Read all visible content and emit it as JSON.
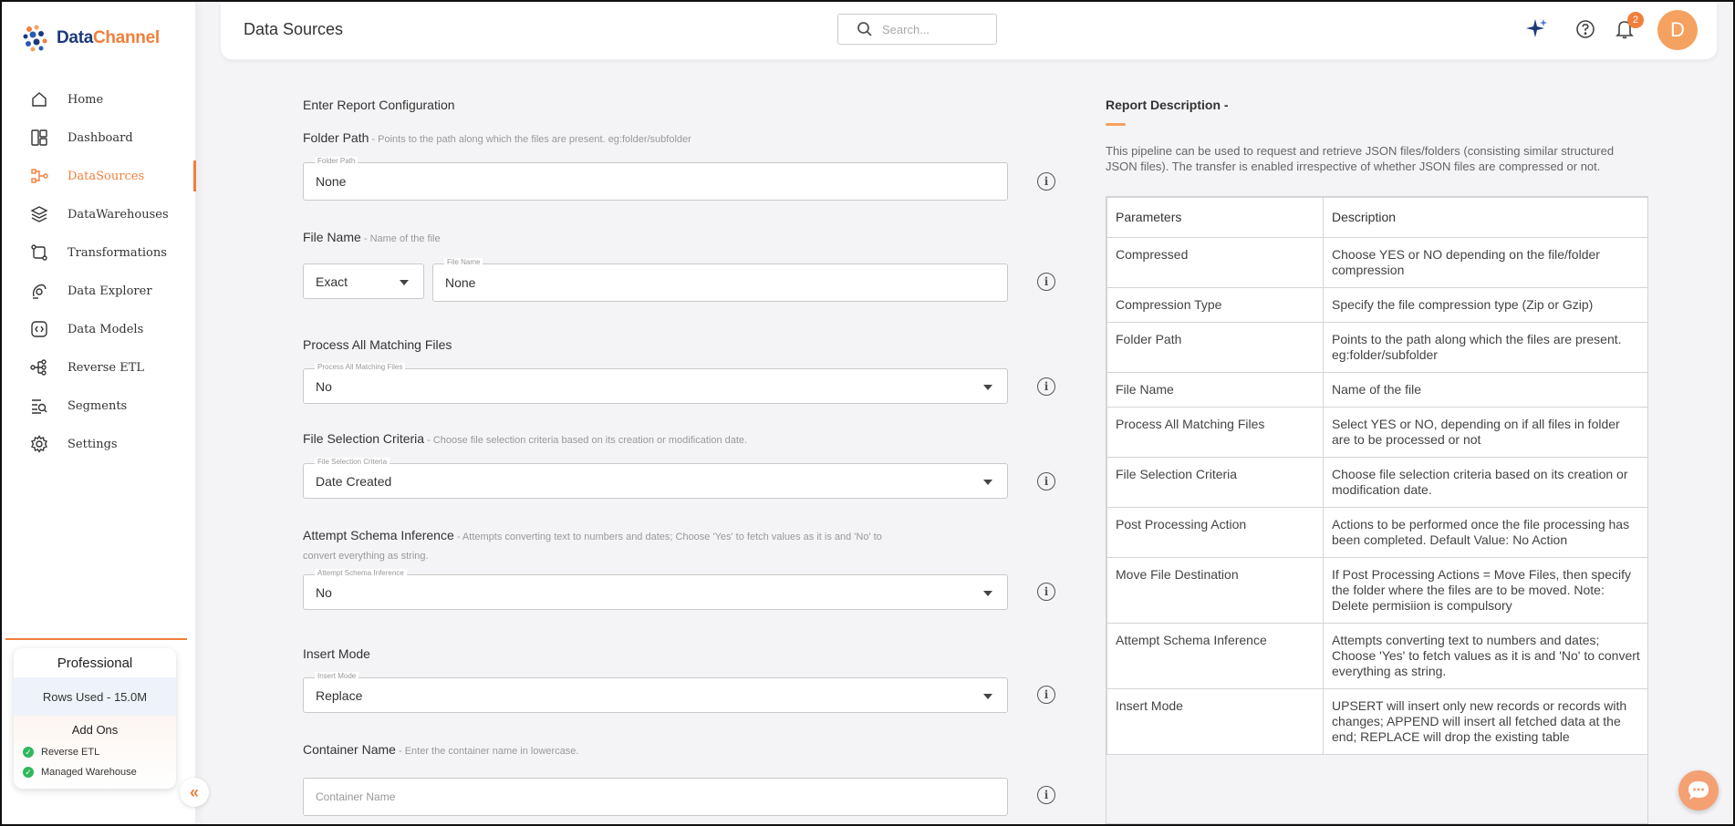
{
  "brand": {
    "part1": "Data",
    "part2": "Channel"
  },
  "sidebar": {
    "items": [
      {
        "label": "Home",
        "icon": "home-icon"
      },
      {
        "label": "Dashboard",
        "icon": "dashboard-icon"
      },
      {
        "label": "DataSources",
        "icon": "datasources-icon",
        "active": true
      },
      {
        "label": "DataWarehouses",
        "icon": "warehouse-layers-icon"
      },
      {
        "label": "Transformations",
        "icon": "transform-icon"
      },
      {
        "label": "Data Explorer",
        "icon": "explorer-icon"
      },
      {
        "label": "Data Models",
        "icon": "models-icon"
      },
      {
        "label": "Reverse ETL",
        "icon": "reverse-etl-icon"
      },
      {
        "label": "Segments",
        "icon": "segments-icon"
      },
      {
        "label": "Settings",
        "icon": "gear-icon"
      }
    ],
    "plan": {
      "name": "Professional",
      "rows_used": "Rows Used - 15.0M",
      "addons_title": "Add Ons",
      "addons": [
        "Reverse ETL",
        "Managed Warehouse"
      ]
    }
  },
  "header": {
    "title": "Data Sources",
    "search_placeholder": "Search...",
    "notification_count": "2",
    "avatar_initial": "D"
  },
  "form": {
    "heading": "Enter Report Configuration",
    "folder_path": {
      "label": "Folder Path",
      "hint": " - Points to the path along which the files are present. eg:folder/subfolder",
      "float": "Folder Path",
      "value": "None"
    },
    "file_name": {
      "label": "File Name",
      "hint": " - Name of the file",
      "match": "Exact",
      "float": "File Name",
      "value": "None"
    },
    "process_all": {
      "label": "Process All Matching Files",
      "float": "Process All Matching Files",
      "value": "No"
    },
    "selection": {
      "label": "File Selection Criteria",
      "hint": " - Choose file selection criteria based on its creation or modification date.",
      "float": "File Selection Criteria",
      "value": "Date Created"
    },
    "schema": {
      "label": "Attempt Schema Inference",
      "hint": " - Attempts converting text to numbers and dates; Choose 'Yes' to fetch values as it is and 'No' to",
      "hint2": "convert everything as string.",
      "float": "Attempt Schema Inference",
      "value": "No"
    },
    "insert_mode": {
      "label": "Insert Mode",
      "float": "Insert Mode",
      "value": "Replace"
    },
    "container": {
      "label": "Container Name",
      "hint": " - Enter the container name in lowercase.",
      "placeholder": "Container Name"
    }
  },
  "description": {
    "title": "Report Description -",
    "text": "This pipeline can be used to request and retrieve JSON files/folders (consisting similar structured JSON files). The transfer is enabled irrespective of whether JSON files are compressed or not.",
    "columns": [
      "Parameters",
      "Description"
    ],
    "rows": [
      [
        "Compressed",
        "Choose YES or NO depending on the file/folder compression"
      ],
      [
        "Compression Type",
        "Specify the file compression type (Zip or Gzip)"
      ],
      [
        "Folder Path",
        "Points to the path along which the files are present. eg:folder/subfolder"
      ],
      [
        "File Name",
        "Name of the file"
      ],
      [
        "Process All Matching Files",
        "Select YES or NO, depending on if all files in folder are to be processed or not"
      ],
      [
        "File Selection Criteria",
        "Choose file selection criteria based on its creation or modification date."
      ],
      [
        "Post Processing Action",
        "Actions to be performed once the file processing has been completed. Default Value: No Action"
      ],
      [
        "Move File Destination",
        "If Post Processing Actions = Move Files, then specify the folder where the files are to be moved. Note: Delete permisiion is compulsory"
      ],
      [
        "Attempt Schema Inference",
        "Attempts converting text to numbers and dates; Choose 'Yes' to fetch values as it is and 'No' to convert everything as string."
      ],
      [
        "Insert Mode",
        "UPSERT will insert only new records or records with changes; APPEND will insert all fetched data at the end; REPLACE will drop the existing table"
      ]
    ]
  },
  "colors": {
    "accent": "#f07f3c",
    "brand_dark": "#1b3a7a"
  }
}
